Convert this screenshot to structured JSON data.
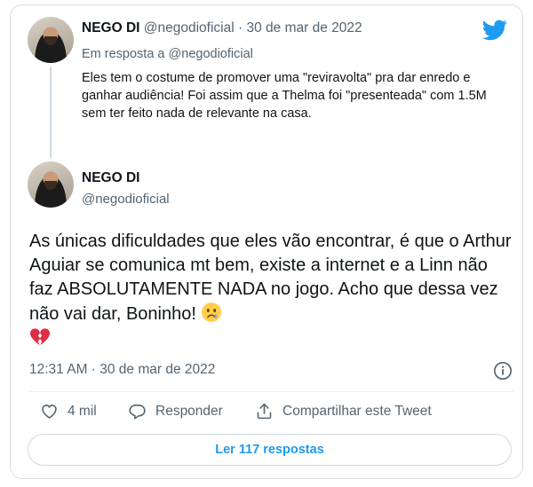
{
  "quoted_tweet": {
    "display_name": "NEGO DI",
    "handle": "@negodioficial",
    "separator": "·",
    "date": "30 de mar de 2022",
    "reply_prefix": "Em resposta a",
    "reply_to": "@negodioficial",
    "text": "Eles tem o costume de promover uma \"reviravolta\" pra dar enredo e ganhar audiência! Foi assim que a Thelma foi \"presenteada\" com 1.5M sem ter feito nada de relevante na casa."
  },
  "main_tweet": {
    "display_name": "NEGO DI",
    "handle": "@negodioficial",
    "text": "As únicas dificuldades que eles vão encontrar, é que o Arthur Aguiar se comunica mt bem, existe a internet e a Linn não faz ABSOLUTAMENTE NADA no jogo. Acho que dessa vez não vai dar, Boninho!",
    "emojis": [
      "crying-face-icon",
      "broken-heart-icon"
    ],
    "timestamp": "12:31 AM · 30 de mar de 2022"
  },
  "actions": {
    "likes": "4 mil",
    "reply_label": "Responder",
    "share_label": "Compartilhar este Tweet"
  },
  "replies_button": "Ler 117 respostas",
  "colors": {
    "brand_blue": "#1d9bf0",
    "secondary_text": "#536471",
    "border": "#cfd9de"
  }
}
